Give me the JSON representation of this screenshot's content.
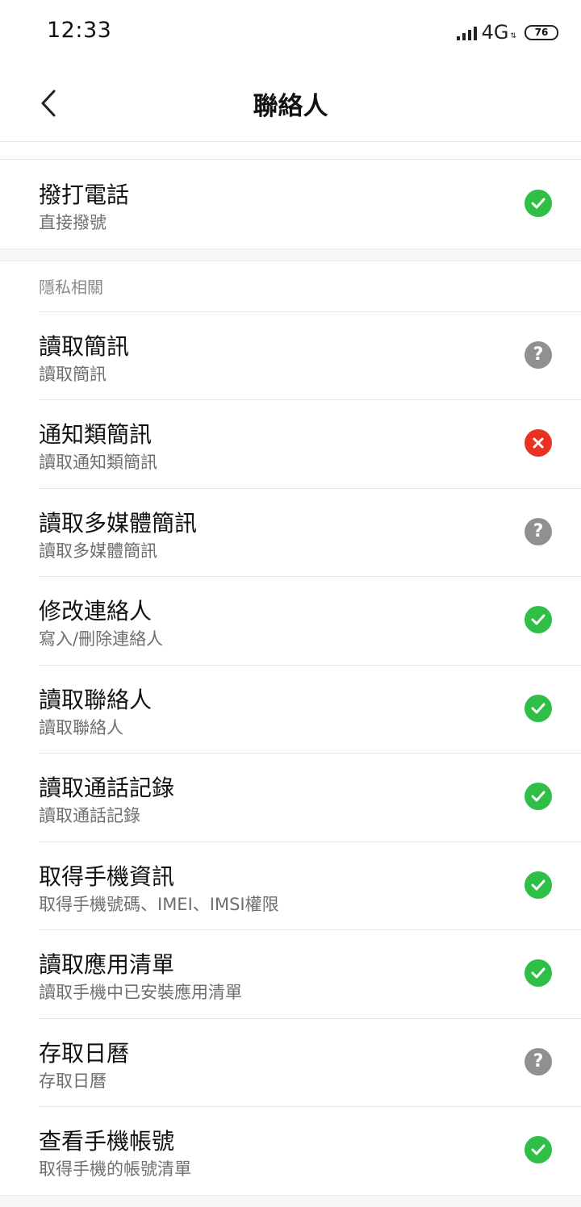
{
  "status_bar": {
    "time": "12:33",
    "network": "4G",
    "battery": "76"
  },
  "header": {
    "back_icon": "chevron-left-icon",
    "title": "聯絡人"
  },
  "top_item": {
    "title": "撥打電話",
    "subtitle": "直接撥號",
    "status": "allow"
  },
  "section": {
    "label": "隱私相關",
    "items": [
      {
        "title": "讀取簡訊",
        "subtitle": "讀取簡訊",
        "status": "ask"
      },
      {
        "title": "通知類簡訊",
        "subtitle": "讀取通知類簡訊",
        "status": "deny"
      },
      {
        "title": "讀取多媒體簡訊",
        "subtitle": "讀取多媒體簡訊",
        "status": "ask"
      },
      {
        "title": "修改連絡人",
        "subtitle": "寫入/刪除連絡人",
        "status": "allow"
      },
      {
        "title": "讀取聯絡人",
        "subtitle": "讀取聯絡人",
        "status": "allow"
      },
      {
        "title": "讀取通話記錄",
        "subtitle": "讀取通話記錄",
        "status": "allow"
      },
      {
        "title": "取得手機資訊",
        "subtitle": "取得手機號碼、IMEI、IMSI權限",
        "status": "allow"
      },
      {
        "title": "讀取應用清單",
        "subtitle": "讀取手機中已安裝應用清單",
        "status": "allow"
      },
      {
        "title": "存取日曆",
        "subtitle": "存取日曆",
        "status": "ask"
      },
      {
        "title": "查看手機帳號",
        "subtitle": "取得手機的帳號清單",
        "status": "allow"
      }
    ]
  },
  "colors": {
    "allow": "#2fbe46",
    "deny": "#ea3223",
    "ask": "#909090"
  }
}
